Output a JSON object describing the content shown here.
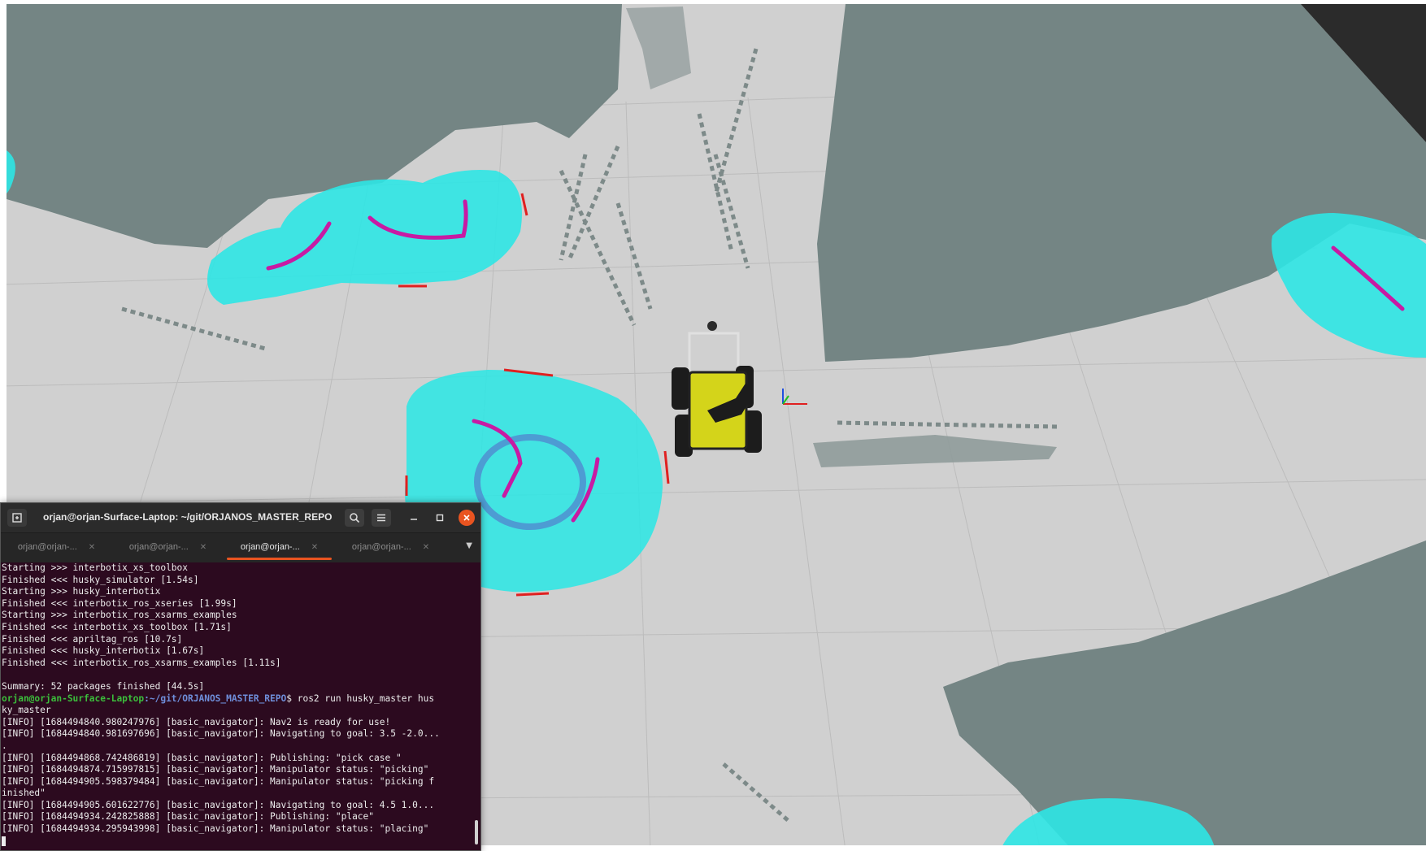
{
  "colors": {
    "free_space": "#d0d0d0",
    "occupied": "#748584",
    "occupied_dark": "#677674",
    "grid_line": "#bcbcbc",
    "inflation": "#2ee6e4",
    "inflation_light": "#5af0ee",
    "inflation_blue": "#4f8fd0",
    "laser_scan": "#c81aa3",
    "goal_marker": "#e02020",
    "robot_body": "#d4d41a",
    "robot_dark": "#1c1c1c",
    "terminal_bg": "#2c0a1f",
    "accent": "#e95420"
  },
  "terminal": {
    "title": "orjan@orjan-Surface-Laptop: ~/git/ORJANOS_MASTER_REPO",
    "icons": {
      "new_tab": "new-tab-icon",
      "search": "search-icon",
      "menu": "hamburger-menu-icon",
      "minimize": "minimize-icon",
      "maximize": "maximize-icon",
      "close": "close-icon"
    },
    "tabs": [
      {
        "label": "orjan@orjan-...",
        "active": false
      },
      {
        "label": "orjan@orjan-...",
        "active": false
      },
      {
        "label": "orjan@orjan-...",
        "active": true
      },
      {
        "label": "orjan@orjan-...",
        "active": false
      }
    ],
    "lines": [
      {
        "text": "Starting >>> interbotix_xs_toolbox"
      },
      {
        "text": "Finished <<< husky_simulator [1.54s]"
      },
      {
        "text": "Starting >>> husky_interbotix"
      },
      {
        "text": "Finished <<< interbotix_ros_xseries [1.99s]"
      },
      {
        "text": "Starting >>> interbotix_ros_xsarms_examples"
      },
      {
        "text": "Finished <<< interbotix_xs_toolbox [1.71s]"
      },
      {
        "text": "Finished <<< apriltag_ros [10.7s]"
      },
      {
        "text": "Finished <<< husky_interbotix [1.67s]"
      },
      {
        "text": "Finished <<< interbotix_ros_xsarms_examples [1.11s]"
      },
      {
        "text": ""
      },
      {
        "text": "Summary: 52 packages finished [44.5s]"
      },
      {
        "prompt_user": "orjan@orjan-Surface-Laptop",
        "prompt_path": ":~/git/ORJANOS_MASTER_REPO",
        "text": "$ ros2 run husky_master hus"
      },
      {
        "text": "ky_master"
      },
      {
        "text": "[INFO] [1684494840.980247976] [basic_navigator]: Nav2 is ready for use!"
      },
      {
        "text": "[INFO] [1684494840.981697696] [basic_navigator]: Navigating to goal: 3.5 -2.0..."
      },
      {
        "text": "."
      },
      {
        "text": "[INFO] [1684494868.742486819] [basic_navigator]: Publishing: \"pick case \""
      },
      {
        "text": "[INFO] [1684494874.715997815] [basic_navigator]: Manipulator status: \"picking\""
      },
      {
        "text": "[INFO] [1684494905.598379484] [basic_navigator]: Manipulator status: \"picking f"
      },
      {
        "text": "inished\""
      },
      {
        "text": "[INFO] [1684494905.601622776] [basic_navigator]: Navigating to goal: 4.5 1.0..."
      },
      {
        "text": "[INFO] [1684494934.242825888] [basic_navigator]: Publishing: \"place\""
      },
      {
        "text": "[INFO] [1684494934.295943998] [basic_navigator]: Manipulator status: \"placing\""
      }
    ]
  }
}
